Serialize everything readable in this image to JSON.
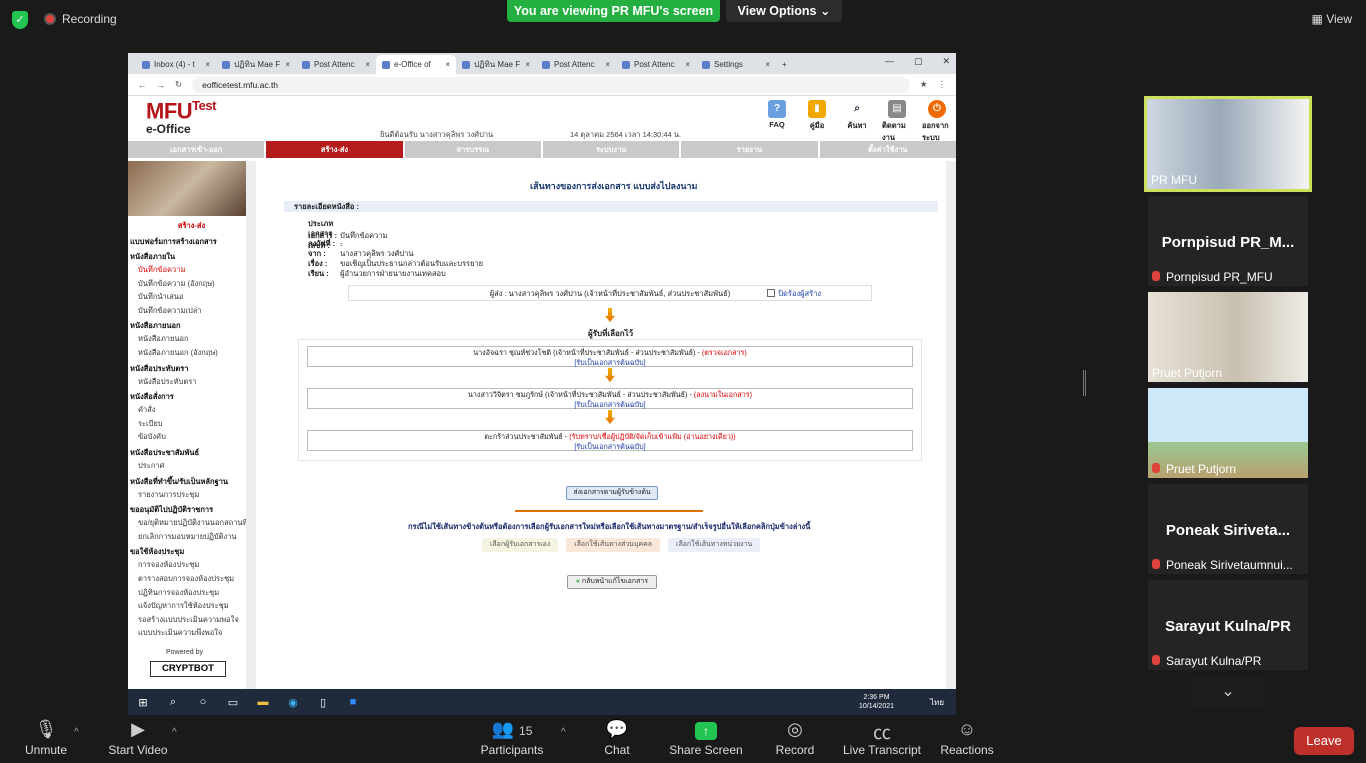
{
  "zoom": {
    "recording": "Recording",
    "viewing_banner": "You are viewing PR MFU's screen",
    "view_options": "View Options",
    "view": "View",
    "bottom": {
      "unmute": "Unmute",
      "start_video": "Start Video",
      "participants": "Participants",
      "participant_count": "15",
      "chat": "Chat",
      "share": "Share Screen",
      "record": "Record",
      "transcript": "Live Transcript",
      "reactions": "Reactions",
      "leave": "Leave"
    },
    "gallery": [
      {
        "name": "PR MFU",
        "type": "video"
      },
      {
        "name": "Pornpisud PR_MFU",
        "big": "Pornpisud  PR_M...",
        "type": "name"
      },
      {
        "name": "Pruet Putjorn",
        "type": "video"
      },
      {
        "name": "Pruet Putjorn",
        "type": "video"
      },
      {
        "name": "Poneak Sirivetaumnui...",
        "big": "Poneak  Sirivetaumnui...",
        "short": "Poneak  Siriveta...",
        "type": "name"
      },
      {
        "name": "Sarayut Kulna/PR",
        "big": "Sarayut Kulna/PR",
        "type": "name"
      }
    ]
  },
  "browser": {
    "tabs": [
      "Inbox (4) - t",
      "ปฏิทิน Mae F",
      "Post Attenc",
      "e-Office of",
      "ปฏิทิน Mae F",
      "Post Attenc",
      "Post Attenc",
      "Settings"
    ],
    "url": "eofficetest.mfu.ac.th"
  },
  "eoffice": {
    "logo": "MFU",
    "logo_sup": "Test",
    "logo_sub": "e-Office",
    "user_line": "ยินดีต้อนรับ  นางสาวคุลิพร วงศ์ปาน",
    "date_line": "14 ตุลาคม 2564  เวลา 14:30:44 น.",
    "icons": [
      "FAQ",
      "คู่มือ",
      "ค้นหา",
      "ติดตามงาน",
      "ออกจากระบบ"
    ],
    "nav": [
      "เอกสารเข้า-ออก",
      "สร้าง-ส่ง",
      "สารบรรณ",
      "ระบบงาน",
      "รายงาน",
      "ตั้งค่าใช้งาน"
    ],
    "left_title": "สร้าง-ส่ง",
    "menu": [
      {
        "t": "แบบฟอร์มการสร้างเอกสาร",
        "s": 1
      },
      {
        "t": "หนังสือภายใน",
        "s": 1
      },
      {
        "t": "บันทึกข้อความ",
        "sel": 1
      },
      {
        "t": "บันทึกข้อความ (อังกฤษ)"
      },
      {
        "t": "บันทึกนำเสนอ"
      },
      {
        "t": "บันทึกข้อความเปล่า"
      },
      {
        "t": "หนังสือภายนอก",
        "s": 1
      },
      {
        "t": "หนังสือภายนอก"
      },
      {
        "t": "หนังสือภายนอก (อังกฤษ)"
      },
      {
        "t": "หนังสือประทับตรา",
        "s": 1
      },
      {
        "t": "หนังสือประทับตรา"
      },
      {
        "t": "หนังสือสั่งการ",
        "s": 1
      },
      {
        "t": "คำสั่ง"
      },
      {
        "t": "ระเบียบ"
      },
      {
        "t": "ข้อบังคับ"
      },
      {
        "t": "หนังสือประชาสัมพันธ์",
        "s": 1
      },
      {
        "t": "ประกาศ"
      },
      {
        "t": "หนังสือที่ทำขึ้น/รับเป็นหลักฐาน",
        "s": 1
      },
      {
        "t": "รายงานการประชุม"
      },
      {
        "t": "ขออนุมัติไปปฏิบัติราชการ",
        "s": 1
      },
      {
        "t": "ขอ/ยุติหมายปฏิบัติงานนอกสถานที่"
      },
      {
        "t": "ยกเลิกการมอบหมายปฏิบัติงาน"
      },
      {
        "t": "ขอใช้ห้องประชุม",
        "s": 1
      },
      {
        "t": "การจองห้องประชุม"
      },
      {
        "t": "ตารางสอบการจองห้องประชุม"
      },
      {
        "t": "ปฏิทินการจองห้องประชุม"
      },
      {
        "t": "แจ้งปัญหาการใช้ห้องประชุม"
      },
      {
        "t": "รอสร้างแบบประเมินความพอใจ"
      },
      {
        "t": "แบบประเมินความพึงพอใจ"
      }
    ],
    "powered": "Powered by",
    "brand": "CRYPTBOT",
    "title": "เส้นทางของการส่งเอกสาร แบบส่งไปลงนาม",
    "detail_header": "รายละเอียดหนังสือ :",
    "details": [
      [
        "ประเภทเอกสาร :",
        "บันทึกข้อความ"
      ],
      [
        "เอกสารเลขที่ :",
        "-"
      ],
      [
        "ลงวันที่ :",
        "-"
      ],
      [
        "จาก :",
        "นางสาวคุลิพร วงศ์ปาน"
      ],
      [
        "เรื่อง :",
        "ขอเชิญเป็นประธานกล่าวต้อนรับและบรรยาย"
      ],
      [
        "เรียน :",
        "ผู้อำนวยการฝ่ายนายงานเทคสอบ"
      ]
    ],
    "sender": "ผู้ส่ง :  นางสาวคุลิพร วงศ์ปาน   (เจ้าหน้าที่ประชาสัมพันธ์, ส่วนประชาสัมพันธ์)",
    "hide_label": "ปิดร้องผู้สร้าง",
    "receivers_title": "ผู้รับที่เลือกไว้",
    "receivers": [
      {
        "name": "นางอัจฉรา ชุณห์ช่วงโชติ (เจ้าหน้าที่ประชาสัมพันธ์ - ส่วนประชาสัมพันธ์) -",
        "status": "(ตรวจเอกสาร)",
        "link": "[รับเป็นเอกสารต้นฉบับ]"
      },
      {
        "name": "นางสาววิจิตรา ชมภูรักษ์ (เจ้าหน้าที่ประชาสัมพันธ์ - ส่วนประชาสัมพันธ์) -",
        "status": "(ลงนามในเอกสาร)",
        "link": "[รับเป็นเอกสารต้นฉบับ]"
      },
      {
        "name": "ตะกร้าส่วนประชาสัมพันธ์ -",
        "status": "(รับทราบ/เชื่อผู้ปฏิบัติ/จัดเก็บเข้าแฟ้ม (อ่านอย่างเดียว))",
        "link": "[รับเป็นเอกสารต้นฉบับ]"
      }
    ],
    "send_btn": "ส่งเอกสารตามผู้รับข้างต้น",
    "note": "กรณีไม่ใช้เส้นทางข้างต้นหรือต้องการเลือกผู้รับเอกสารใหม่หรือเลือกใช้เส้นทางมาตรฐาน/สำเร็จรูปอื่นให้เลือกคลิกปุ่มข้างล่างนี้",
    "opts": [
      "เลือกผู้รับเอกสารเอง",
      "เลือกใช้เส้นทางส่วนบุคคล",
      "เลือกใช้เส้นทางหน่วยงาน"
    ],
    "back_btn": "กลับหน้าแก้ไขเอกสาร"
  },
  "taskbar": {
    "time": "2:36 PM",
    "date": "10/14/2021",
    "lang": "ไทย"
  }
}
